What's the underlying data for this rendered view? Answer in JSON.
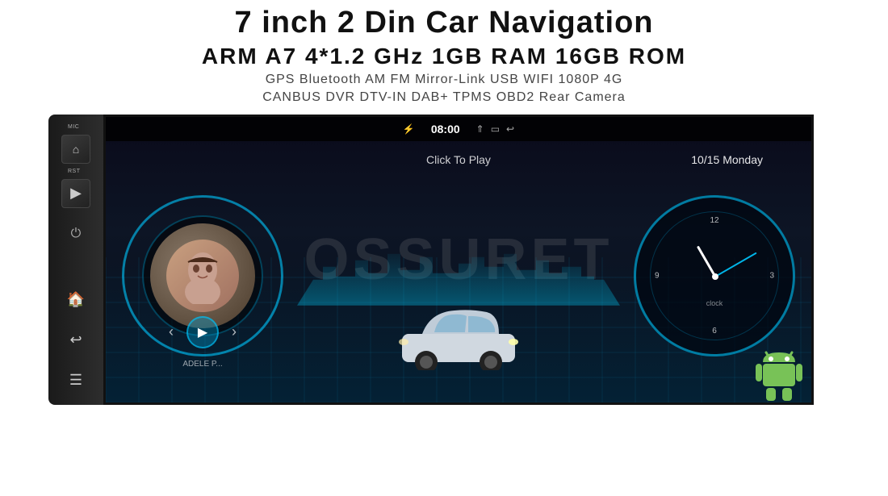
{
  "header": {
    "title": "7 inch 2 Din Car Navigation",
    "specs": "ARM A7 4*1.2 GHz    1GB RAM    16GB ROM",
    "features_row1": "GPS  Bluetooth  AM  FM  Mirror-Link  USB  WIFI  1080P  4G",
    "features_row2": "CANBUS   DVR   DTV-IN   DAB+   TPMS   OBD2   Rear Camera"
  },
  "screen": {
    "status_bar": {
      "bluetooth_icon": "bluetooth",
      "time": "08:00",
      "icons_right": [
        "chevron-up",
        "window",
        "back"
      ]
    },
    "click_to_play": "Click To Play",
    "date": "10/15 Monday",
    "music_label": "ADELE P...",
    "clock_label": "clock",
    "clock_numbers": {
      "twelve": "12",
      "three": "3",
      "six": "6",
      "nine": "9"
    }
  },
  "side_panel": {
    "mic_label": "MIC",
    "rst_label": "RST",
    "icons": [
      "home",
      "back"
    ]
  },
  "watermark": "OSSURET"
}
